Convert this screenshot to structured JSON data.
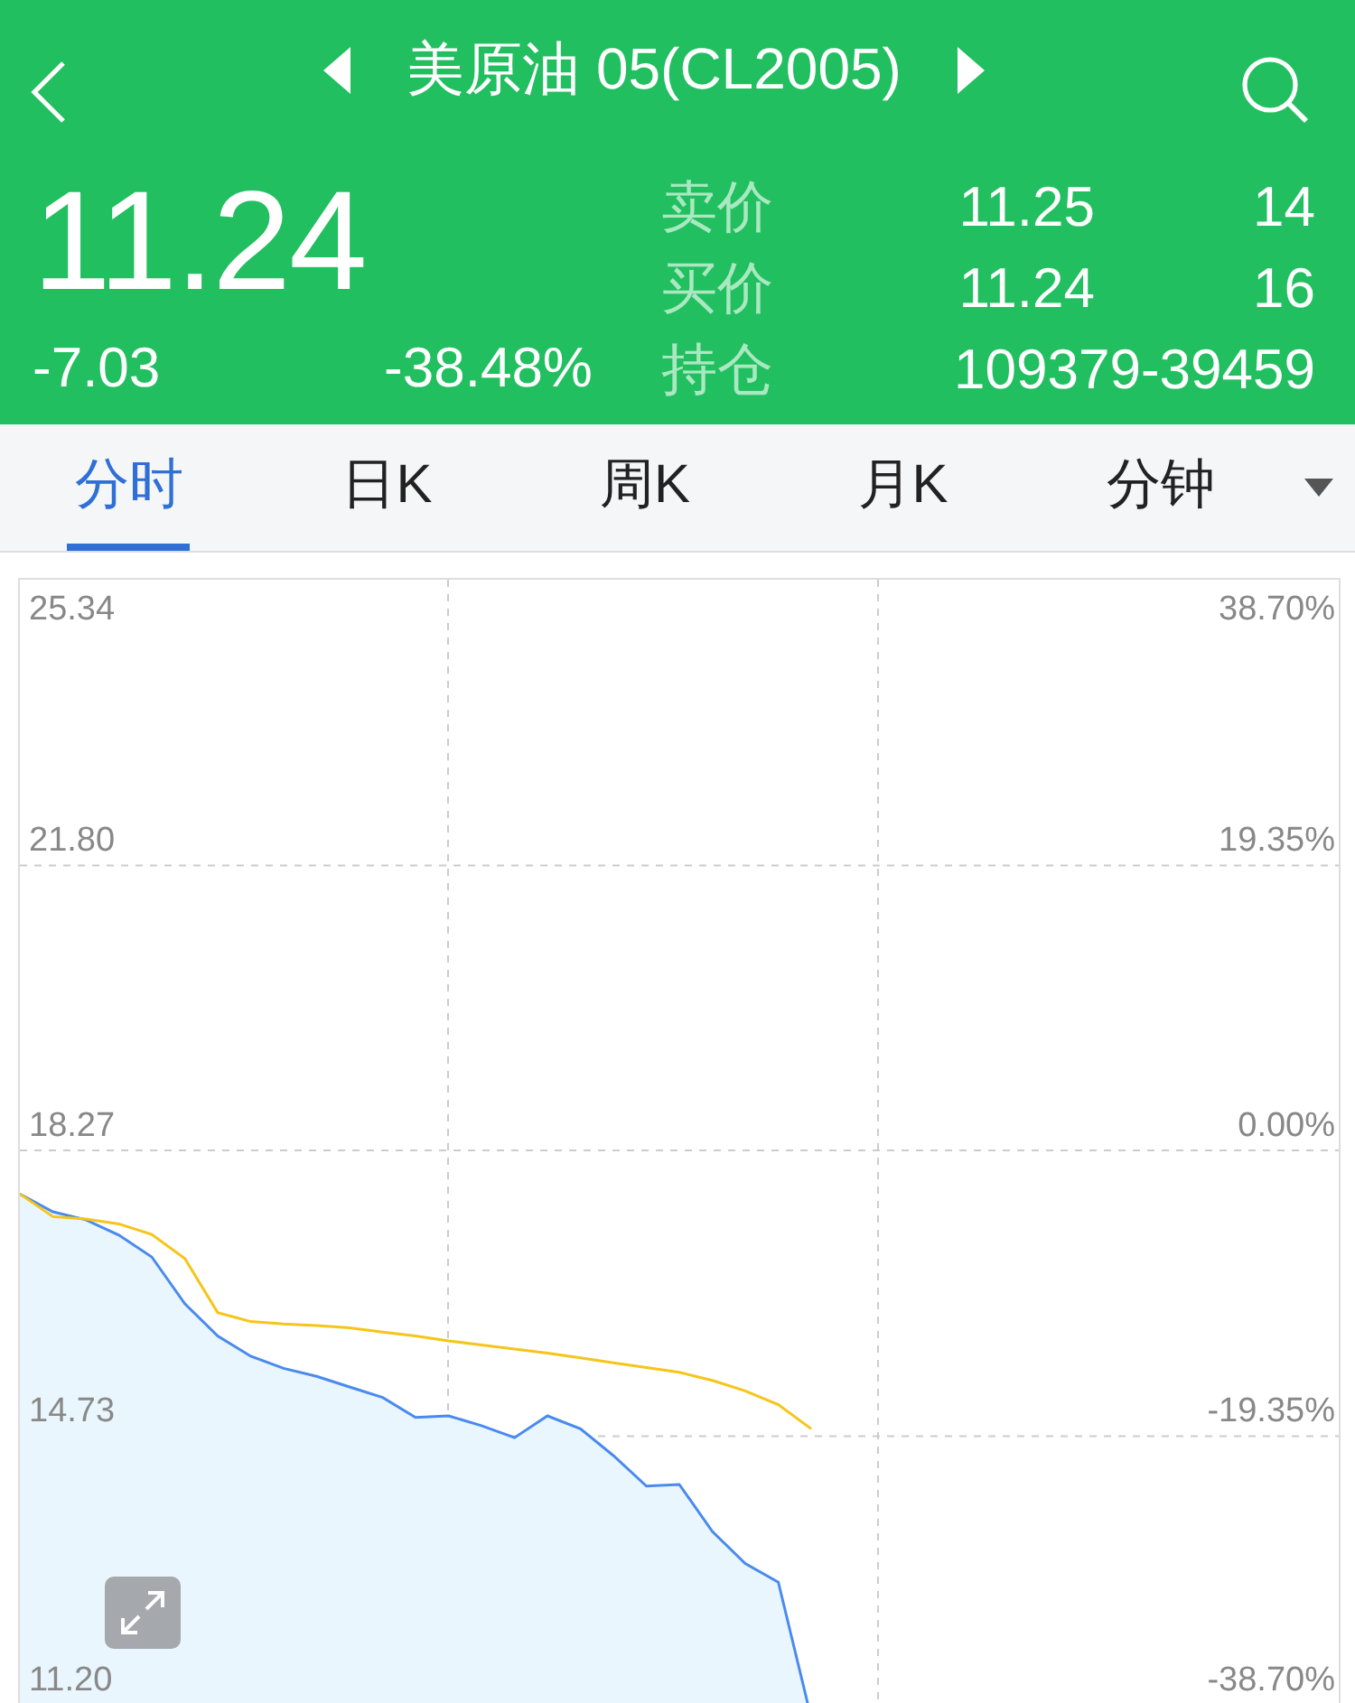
{
  "header": {
    "title": "美原油 05(CL2005)",
    "price": "11.24",
    "change": "-7.03",
    "change_pct": "-38.48%",
    "quotes": [
      {
        "label": "卖价",
        "price": "11.25",
        "volume": "14"
      },
      {
        "label": "买价",
        "price": "11.24",
        "volume": "16"
      },
      {
        "label": "持仓",
        "value": "109379-39459"
      }
    ]
  },
  "tabs": [
    {
      "label": "分时",
      "selected": true
    },
    {
      "label": "日K",
      "selected": false
    },
    {
      "label": "周K",
      "selected": false
    },
    {
      "label": "月K",
      "selected": false
    },
    {
      "label": "分钟",
      "selected": false
    }
  ],
  "chart": {
    "chart_data": {
      "type": "line",
      "grid": true,
      "ylim": [
        11.2,
        25.34
      ],
      "categories": [
        null,
        null,
        null,
        null,
        null,
        null,
        null,
        null,
        null,
        null,
        null,
        null,
        null,
        null,
        null,
        null,
        null,
        null,
        null,
        null,
        null,
        null,
        null,
        null,
        null,
        null,
        null,
        null,
        null,
        null,
        null,
        null,
        null,
        null,
        null,
        null,
        null,
        null,
        null,
        null
      ],
      "yticks": [
        {
          "value": 21.8,
          "label": "21.80"
        },
        {
          "value": 18.27,
          "label": "18.27"
        },
        {
          "value": 14.73,
          "label": "14.73"
        },
        {
          "value": 11.2,
          "label": "11.20"
        }
      ],
      "series": [
        {
          "color": "#4a8af0",
          "values": [
            17.73,
            17.51,
            17.41,
            17.22,
            16.95,
            16.37,
            15.97,
            15.72,
            15.57,
            15.47,
            15.34,
            15.21,
            14.96,
            14.98,
            14.86,
            14.71,
            14.98,
            14.82,
            14.49,
            14.11,
            14.13,
            13.55,
            13.15,
            12.92,
            11.24,
            null,
            null,
            null,
            null,
            null,
            null,
            null,
            null,
            null,
            null,
            null,
            null,
            null,
            null,
            null
          ]
        },
        {
          "color": "#f5c518",
          "values": [
            17.73,
            17.45,
            17.42,
            17.36,
            17.23,
            16.93,
            16.26,
            16.15,
            16.12,
            16.1,
            16.07,
            16.02,
            15.97,
            15.91,
            15.86,
            15.81,
            15.76,
            15.7,
            15.64,
            15.58,
            15.52,
            15.42,
            15.29,
            15.12,
            14.82,
            null,
            null,
            null,
            null,
            null,
            null,
            null,
            null,
            null,
            null,
            null,
            null,
            null,
            null,
            null
          ]
        }
      ]
    },
    "top_label": "25.34",
    "top_right_label": "38.70%",
    "right_labels": [
      "19.35%",
      "0.00%",
      "-19.35%",
      "-38.70%"
    ]
  }
}
